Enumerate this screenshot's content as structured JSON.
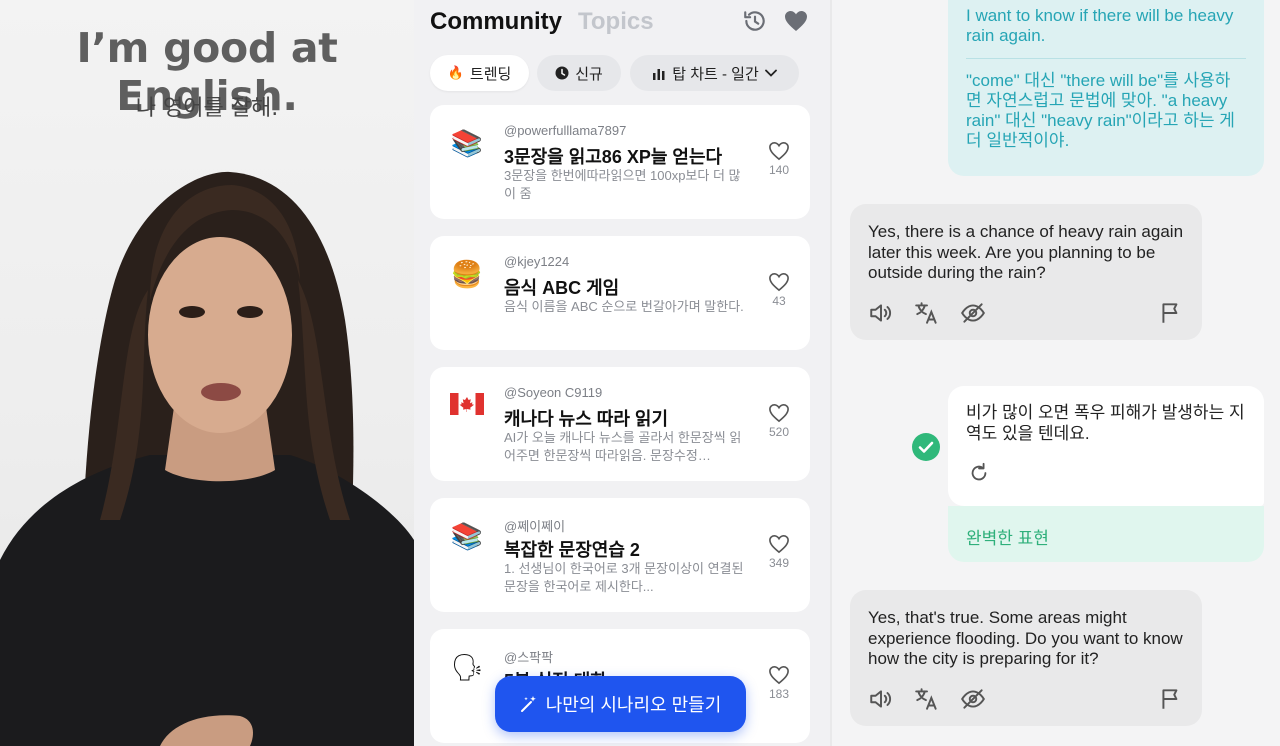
{
  "video": {
    "caption_en": "I’m good at English.",
    "caption_ko": "나 영어를 잘해."
  },
  "community": {
    "title": "Community",
    "topics_tab": "Topics",
    "filters": [
      {
        "icon": "fire-icon",
        "label": "트렌딩",
        "active": true
      },
      {
        "icon": "clock-icon",
        "label": "신규",
        "active": false
      },
      {
        "icon": "chart-icon",
        "label": "탑 차트 - 일간",
        "active": false
      }
    ],
    "cards": [
      {
        "emoji": "📚",
        "user": "@powerfulllama7897",
        "title": "3문장을 읽고86 XP늘 얻는다",
        "desc": "3문장을 한번에따라읽으면 100xp보다 더 많이 줌",
        "likes": "140"
      },
      {
        "emoji": "🍔",
        "user": "@kjey1224",
        "title": "음식 ABC 게임",
        "desc": "음식 이름을 ABC 순으로 번갈아가며 말한다.",
        "likes": "43"
      },
      {
        "emoji": "🇨🇦",
        "user": "@Soyeon C9119",
        "title": "캐나다 뉴스 따라 읽기",
        "desc": "AI가 오늘 캐나다 뉴스를 골라서 한문장씩 읽어주면 한문장씩 따라읽음. 문장수정…",
        "likes": "520"
      },
      {
        "emoji": "📚",
        "user": "@쩨이쩨이",
        "title": "복잡한 문장연습 2",
        "desc": "1. 선생님이 한국어로 3개 문장이상이 연결된 문장을 한국어로 제시한다...",
        "likes": "349"
      },
      {
        "emoji": "🗣",
        "user": "@스팍팍",
        "title": "5분 실전 대화",
        "desc": "",
        "likes": "183"
      }
    ],
    "fab_label": "나만의 시나리오 만들기"
  },
  "chat": {
    "user_top": "I want to know if there will be heavy rain again.",
    "correction": "\"come\" 대신 \"there will be\"를 사용하면 자연스럽고 문법에 맞아. \"a heavy rain\" 대신 \"heavy rain\"이라고 하는 게 더 일반적이야.",
    "ai_1": "Yes, there is a chance of heavy rain again later this week. Are you planning to be outside during the rain?",
    "me_2": "비가 많이 오면 폭우 피해가 발생하는 지역도 있을 텐데요.",
    "feedback": "완벽한 표현",
    "ai_2": "Yes, that's true. Some areas might experience flooding. Do you want to know how the city is preparing for it?"
  }
}
